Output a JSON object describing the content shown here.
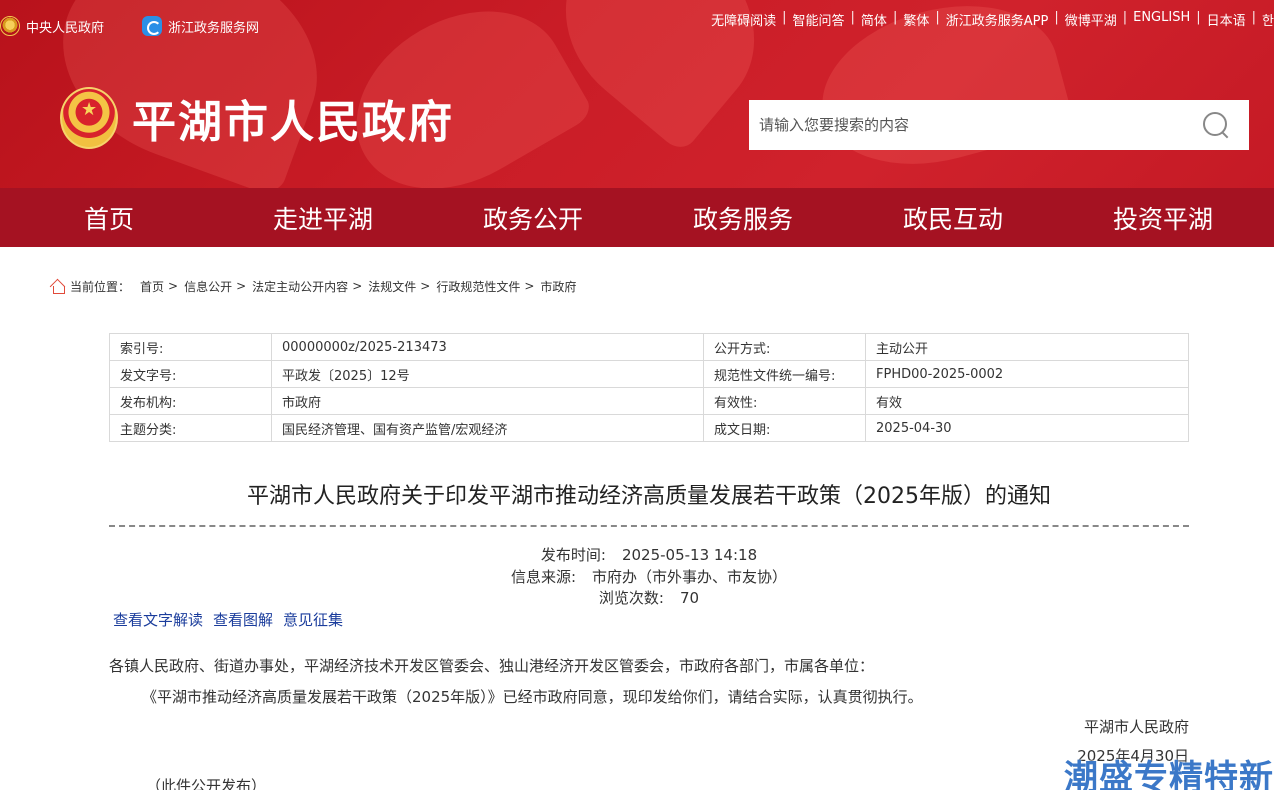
{
  "topbar": {
    "left_links": [
      "中央人民政府",
      "浙江政务服务网"
    ],
    "right_links": [
      "无障碍阅读",
      "智能问答",
      "简体",
      "繁体",
      "浙江政务服务APP",
      "微博平湖",
      "ENGLISH",
      "日本语",
      "한"
    ]
  },
  "site": {
    "title": "平湖市人民政府"
  },
  "search": {
    "placeholder": "请输入您要搜索的内容"
  },
  "nav": [
    "首页",
    "走进平湖",
    "政务公开",
    "政务服务",
    "政民互动",
    "投资平湖"
  ],
  "breadcrumb": {
    "label": "当前位置：",
    "items": [
      "首页",
      "信息公开",
      "法定主动公开内容",
      "法规文件",
      "行政规范性文件",
      "市政府"
    ]
  },
  "meta": {
    "rows": [
      [
        "索引号:",
        "00000000z/2025-213473",
        "公开方式:",
        "主动公开"
      ],
      [
        "发文字号:",
        "平政发〔2025〕12号",
        "规范性文件统一编号:",
        "FPHD00-2025-0002"
      ],
      [
        "发布机构:",
        "市政府",
        "有效性:",
        "有效"
      ],
      [
        "主题分类:",
        "国民经济管理、国有资产监管/宏观经济",
        "成文日期:",
        "2025-04-30"
      ]
    ]
  },
  "article": {
    "title": "平湖市人民政府关于印发平湖市推动经济高质量发展若干政策（2025年版）的通知",
    "pub_time_label": "发布时间:",
    "pub_time": "2025-05-13 14:18",
    "source_label": "信息来源:",
    "source": "市府办（市外事办、市友协）",
    "views_label": "浏览次数:",
    "views": "70",
    "links": [
      "查看文字解读",
      "查看图解",
      "意见征集"
    ],
    "recipients": "各镇人民政府、街道办事处，平湖经济技术开发区管委会、独山港经济开发区管委会，市政府各部门，市属各单位：",
    "body": "《平湖市推动经济高质量发展若干政策（2025年版）》已经市政府同意，现印发给你们，请结合实际，认真贯彻执行。",
    "signature": "平湖市人民政府",
    "date": "2025年4月30日",
    "note": "（此件公开发布）"
  },
  "watermark": "潮盛专精特新"
}
